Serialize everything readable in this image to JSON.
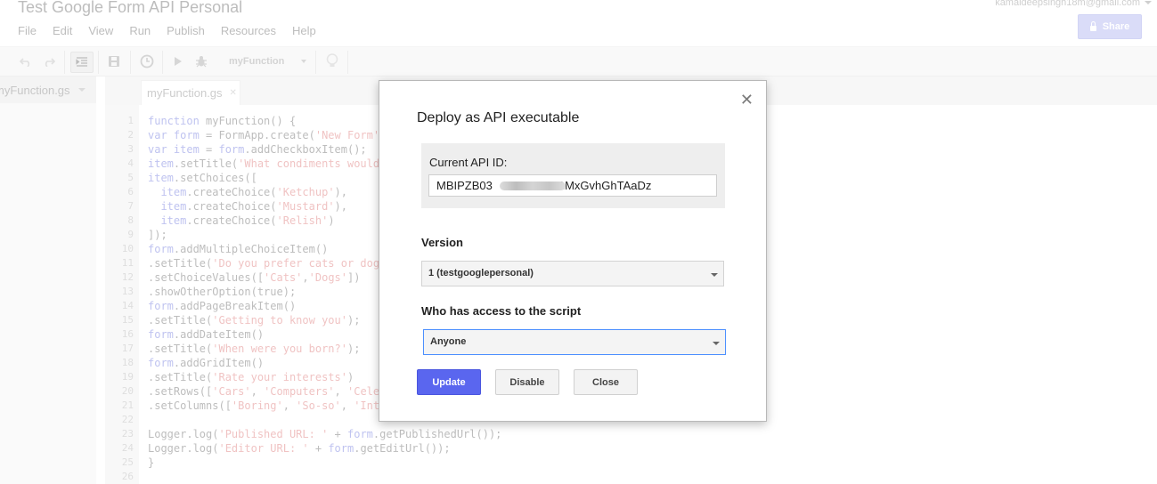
{
  "app": {
    "title": "Test Google Form API Personal",
    "user_email": "kamaldeepsingh18m@gmail.com",
    "share_label": "Share"
  },
  "menu": [
    "File",
    "Edit",
    "View",
    "Run",
    "Publish",
    "Resources",
    "Help"
  ],
  "toolbar": {
    "function_select": "myFunction"
  },
  "sidebar": {
    "file_name": "myFunction.gs"
  },
  "editor": {
    "tab_label": "myFunction.gs",
    "lines": [
      {
        "n": "1",
        "parts": [
          [
            "kw",
            "function"
          ],
          [
            "pl",
            " myFunction() {"
          ]
        ]
      },
      {
        "n": "2",
        "parts": [
          [
            "kw",
            "var form"
          ],
          [
            "pl",
            " = FormApp.create("
          ],
          [
            "str",
            "'New Form'"
          ]
        ]
      },
      {
        "n": "3",
        "parts": [
          [
            "kw",
            "var item"
          ],
          [
            "pl",
            " = "
          ],
          [
            "kw",
            "form"
          ],
          [
            "pl",
            ".addCheckboxItem();"
          ]
        ]
      },
      {
        "n": "4",
        "parts": [
          [
            "kw",
            "item"
          ],
          [
            "pl",
            ".setTitle("
          ],
          [
            "str",
            "'What condiments would"
          ]
        ]
      },
      {
        "n": "5",
        "parts": [
          [
            "kw",
            "item"
          ],
          [
            "pl",
            ".setChoices(["
          ]
        ]
      },
      {
        "n": "6",
        "parts": [
          [
            "pl",
            "  "
          ],
          [
            "kw",
            "item"
          ],
          [
            "pl",
            ".createChoice("
          ],
          [
            "str",
            "'Ketchup'"
          ],
          [
            "pl",
            "),"
          ]
        ]
      },
      {
        "n": "7",
        "parts": [
          [
            "pl",
            "  "
          ],
          [
            "kw",
            "item"
          ],
          [
            "pl",
            ".createChoice("
          ],
          [
            "str",
            "'Mustard'"
          ],
          [
            "pl",
            "),"
          ]
        ]
      },
      {
        "n": "8",
        "parts": [
          [
            "pl",
            "  "
          ],
          [
            "kw",
            "item"
          ],
          [
            "pl",
            ".createChoice("
          ],
          [
            "str",
            "'Relish'"
          ],
          [
            "pl",
            ")"
          ]
        ]
      },
      {
        "n": "9",
        "parts": [
          [
            "pl",
            "]);"
          ]
        ]
      },
      {
        "n": "10",
        "parts": [
          [
            "kw",
            "form"
          ],
          [
            "pl",
            ".addMultipleChoiceItem()"
          ]
        ]
      },
      {
        "n": "11",
        "parts": [
          [
            "pl",
            ".setTitle("
          ],
          [
            "str",
            "'Do you prefer cats or dog"
          ]
        ]
      },
      {
        "n": "12",
        "parts": [
          [
            "pl",
            ".setChoiceValues(["
          ],
          [
            "str",
            "'Cats'"
          ],
          [
            "pl",
            ","
          ],
          [
            "str",
            "'Dogs'"
          ],
          [
            "pl",
            "])"
          ]
        ]
      },
      {
        "n": "13",
        "parts": [
          [
            "pl",
            ".showOtherOption(true);"
          ]
        ]
      },
      {
        "n": "14",
        "parts": [
          [
            "kw",
            "form"
          ],
          [
            "pl",
            ".addPageBreakItem()"
          ]
        ]
      },
      {
        "n": "15",
        "parts": [
          [
            "pl",
            ".setTitle("
          ],
          [
            "str",
            "'Getting to know you'"
          ],
          [
            "pl",
            ");"
          ]
        ]
      },
      {
        "n": "16",
        "parts": [
          [
            "kw",
            "form"
          ],
          [
            "pl",
            ".addDateItem()"
          ]
        ]
      },
      {
        "n": "17",
        "parts": [
          [
            "pl",
            ".setTitle("
          ],
          [
            "str",
            "'When were you born?'"
          ],
          [
            "pl",
            ");"
          ]
        ]
      },
      {
        "n": "18",
        "parts": [
          [
            "kw",
            "form"
          ],
          [
            "pl",
            ".addGridItem()"
          ]
        ]
      },
      {
        "n": "19",
        "parts": [
          [
            "pl",
            ".setTitle("
          ],
          [
            "str",
            "'Rate your interests'"
          ],
          [
            "pl",
            ")"
          ]
        ]
      },
      {
        "n": "20",
        "parts": [
          [
            "pl",
            ".setRows(["
          ],
          [
            "str",
            "'Cars'"
          ],
          [
            "pl",
            ", "
          ],
          [
            "str",
            "'Computers'"
          ],
          [
            "pl",
            ", "
          ],
          [
            "str",
            "'Cele"
          ]
        ]
      },
      {
        "n": "21",
        "parts": [
          [
            "pl",
            ".setColumns(["
          ],
          [
            "str",
            "'Boring'"
          ],
          [
            "pl",
            ", "
          ],
          [
            "str",
            "'So-so'"
          ],
          [
            "pl",
            ", "
          ],
          [
            "str",
            "'Int"
          ]
        ]
      },
      {
        "n": "22",
        "parts": [
          [
            "pl",
            ""
          ]
        ]
      },
      {
        "n": "23",
        "parts": [
          [
            "pl",
            "Logger.log("
          ],
          [
            "str",
            "'Published URL: '"
          ],
          [
            "pl",
            " + "
          ],
          [
            "kw",
            "form"
          ],
          [
            "pl",
            ".getPublishedUrl());"
          ]
        ]
      },
      {
        "n": "24",
        "parts": [
          [
            "pl",
            "Logger.log("
          ],
          [
            "str",
            "'Editor URL: '"
          ],
          [
            "pl",
            " + "
          ],
          [
            "kw",
            "form"
          ],
          [
            "pl",
            ".getEditUrl());"
          ]
        ]
      },
      {
        "n": "25",
        "parts": [
          [
            "pl",
            "}"
          ]
        ]
      },
      {
        "n": "26",
        "parts": [
          [
            "pl",
            ""
          ]
        ]
      }
    ]
  },
  "dialog": {
    "title": "Deploy as API executable",
    "close_glyph": "✕",
    "api_id_label": "Current API ID:",
    "api_id_prefix": "MBIPZB03",
    "api_id_suffix": "1MxGvhGhTAaDz",
    "version_label": "Version",
    "version_value": "1 (testgooglepersonal)",
    "access_label": "Who has access to the script",
    "access_value": "Anyone",
    "buttons": {
      "update": "Update",
      "disable": "Disable",
      "close": "Close"
    }
  },
  "colors": {
    "primary_button": "#5a66ef",
    "share_button": "#c7caf5",
    "focus_border": "#4d90fe"
  }
}
